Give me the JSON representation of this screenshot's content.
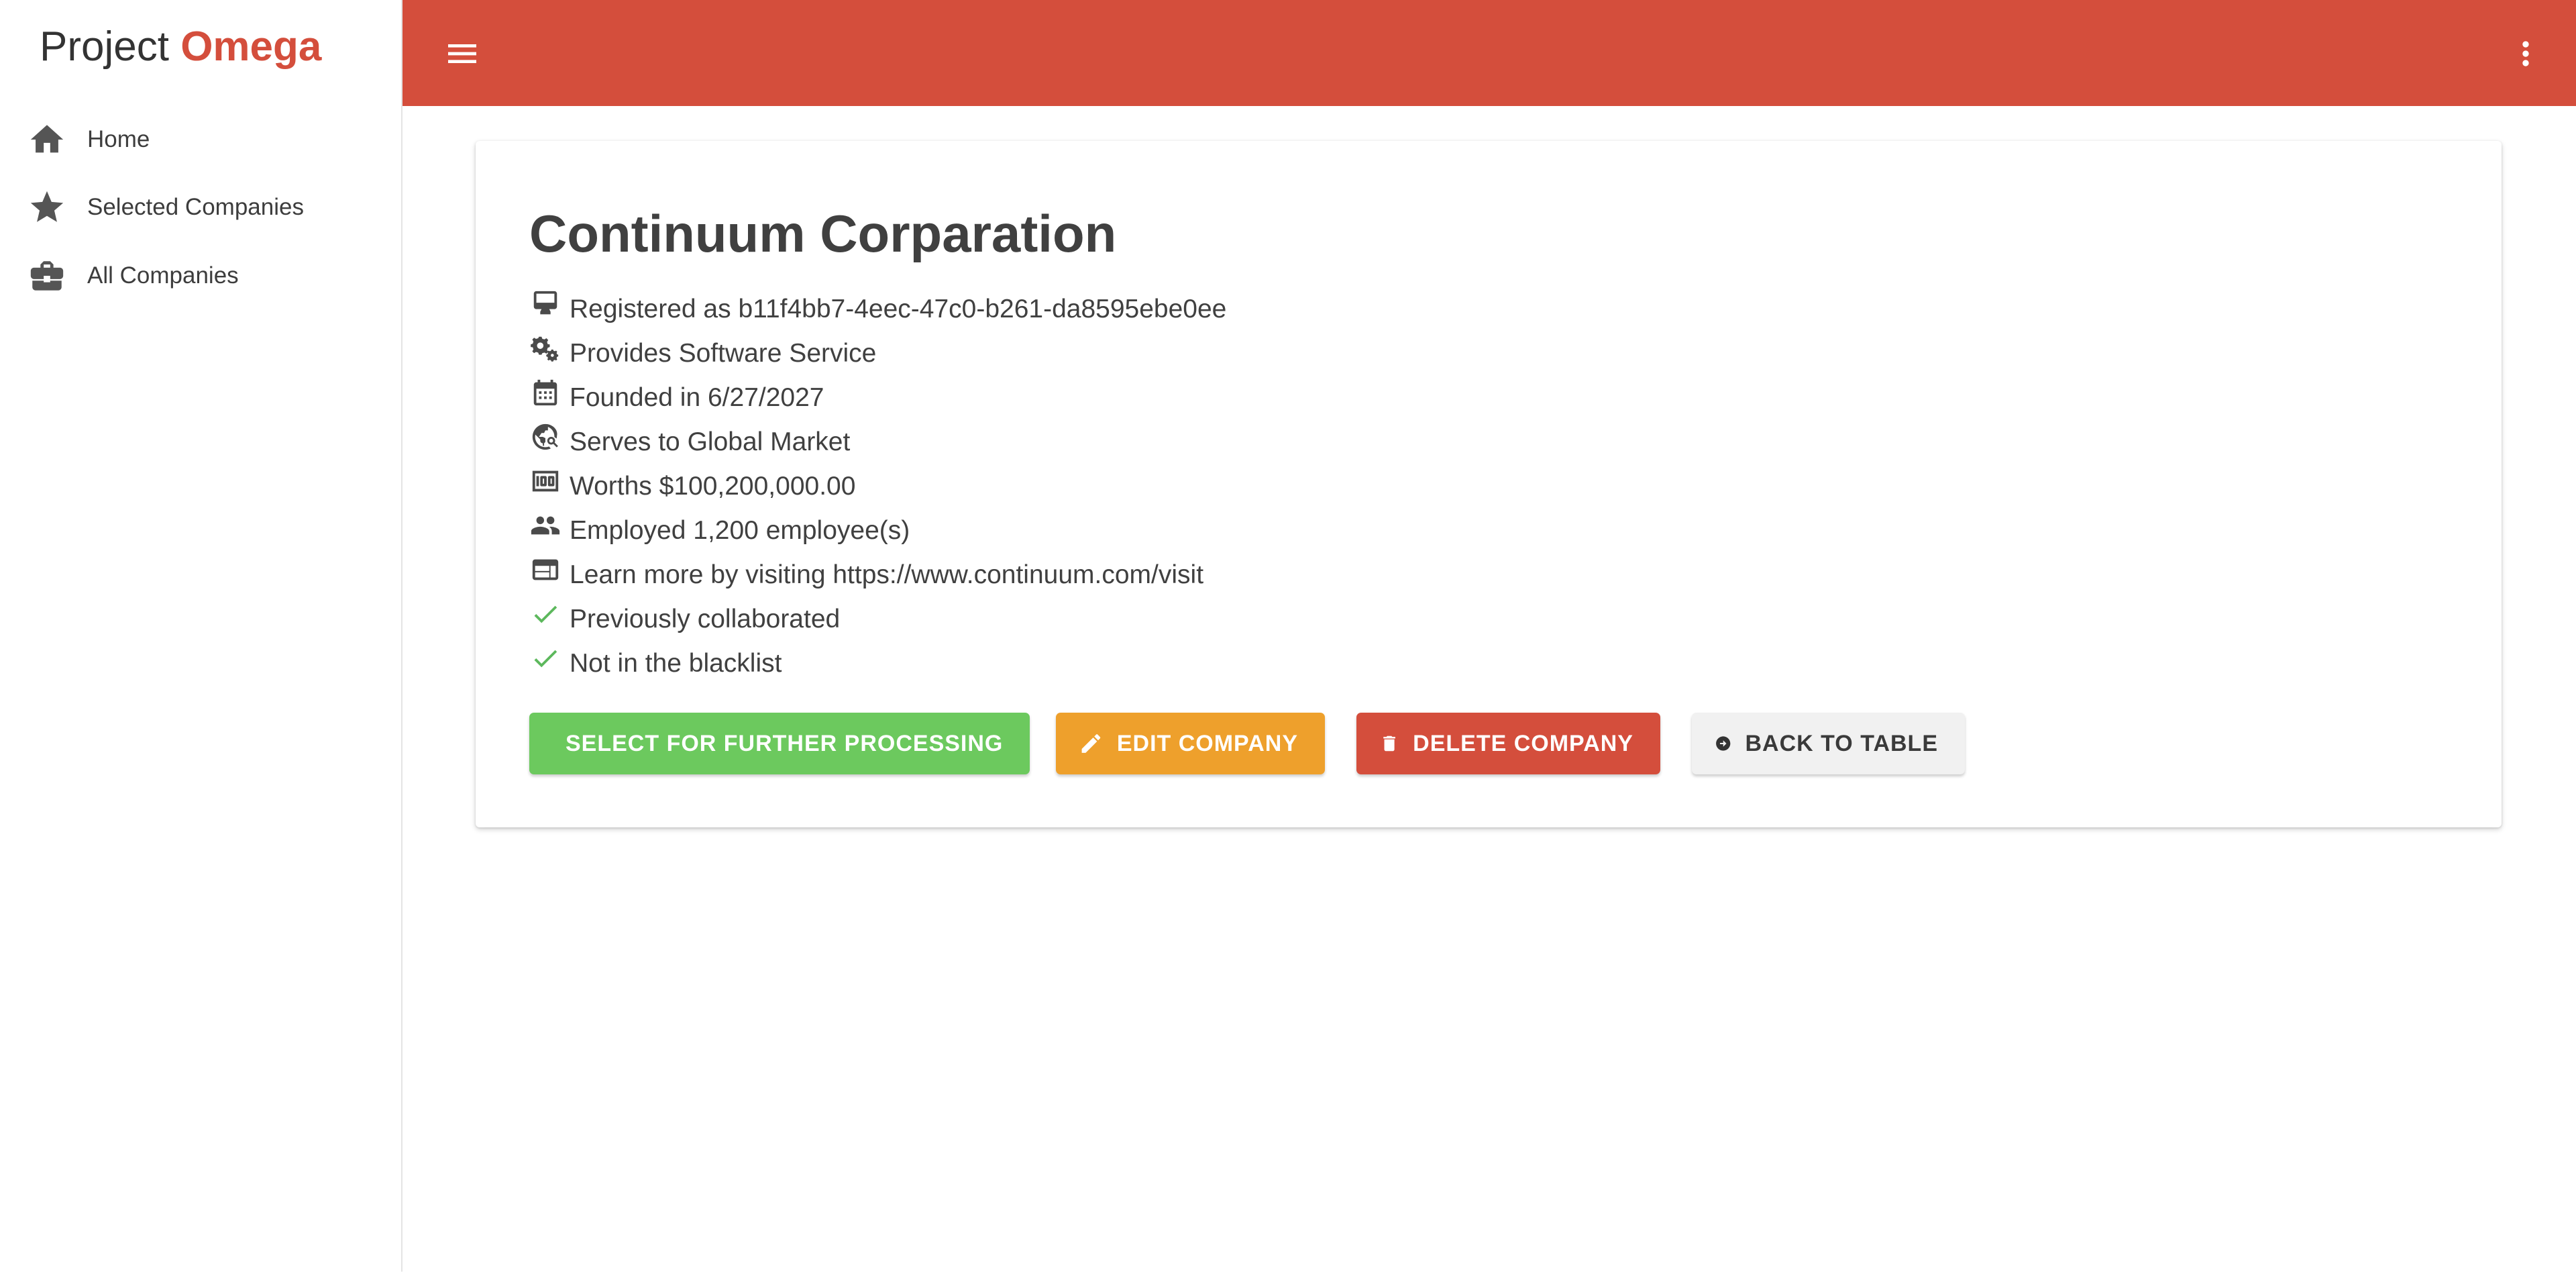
{
  "brand": {
    "prefix": "Project ",
    "highlight": "Omega"
  },
  "sidebar": {
    "items": [
      {
        "label": "Home",
        "icon": "home-icon"
      },
      {
        "label": "Selected Companies",
        "icon": "star-icon"
      },
      {
        "label": "All Companies",
        "icon": "briefcase-icon"
      }
    ]
  },
  "topbar": {
    "menu_icon": "menu-icon",
    "more_icon": "more-vert-icon"
  },
  "company": {
    "name": "Continuum Corparation",
    "details": [
      {
        "icon": "registration-card-icon",
        "text": "Registered as b11f4bb7-4eec-47c0-b261-da8595ebe0ee"
      },
      {
        "icon": "gears-icon",
        "text": "Provides Software Service"
      },
      {
        "icon": "calendar-icon",
        "text": "Founded in 6/27/2027"
      },
      {
        "icon": "globe-search-icon",
        "text": "Serves to Global Market"
      },
      {
        "icon": "money-icon",
        "text": "Worths $100,200,000.00"
      },
      {
        "icon": "people-icon",
        "text": "Employed 1,200 employee(s)"
      },
      {
        "icon": "web-icon",
        "text": "Learn more by visiting https://www.continuum.com/visit"
      },
      {
        "icon": "check-icon",
        "text": "Previously collaborated"
      },
      {
        "icon": "check-icon",
        "text": "Not in the blacklist"
      }
    ]
  },
  "actions": {
    "select": "SELECT FOR FURTHER PROCESSING",
    "edit": "EDIT COMPANY",
    "delete": "DELETE COMPANY",
    "back": "BACK TO TABLE"
  },
  "colors": {
    "brand_red": "#d44e3c",
    "select_green": "#6cc95e",
    "edit_orange": "#eea02c",
    "check_green": "#5cb85c",
    "back_grey": "#f1f1f1"
  }
}
